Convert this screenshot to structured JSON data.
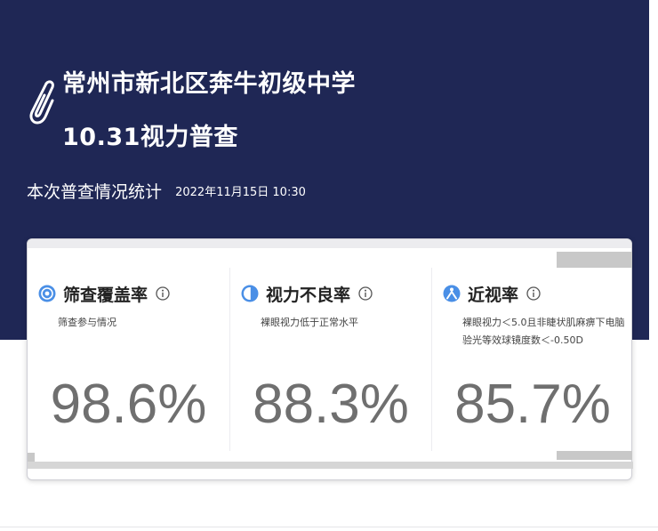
{
  "header": {
    "school": "常州市新北区奔牛初级中学",
    "event": "10.31视力普查",
    "subtitle": "本次普查情况统计",
    "timestamp": "2022年11月15日 10:30"
  },
  "colors": {
    "hero_background": "#1f2755",
    "accent": "#4a8fe6"
  },
  "metrics": [
    {
      "icon": "target-circle-icon",
      "title": "筛查覆盖率",
      "description": "筛查参与情况",
      "value": "98.6%"
    },
    {
      "icon": "half-circle-icon",
      "title": "视力不良率",
      "description": "裸眼视力低于正常水平",
      "value": "88.3%"
    },
    {
      "icon": "person-icon",
      "title": "近视率",
      "description": "裸眼视力＜5.0且非睫状肌麻痹下电脑验光等效球镜度数＜-0.50D",
      "value": "85.7%"
    }
  ]
}
